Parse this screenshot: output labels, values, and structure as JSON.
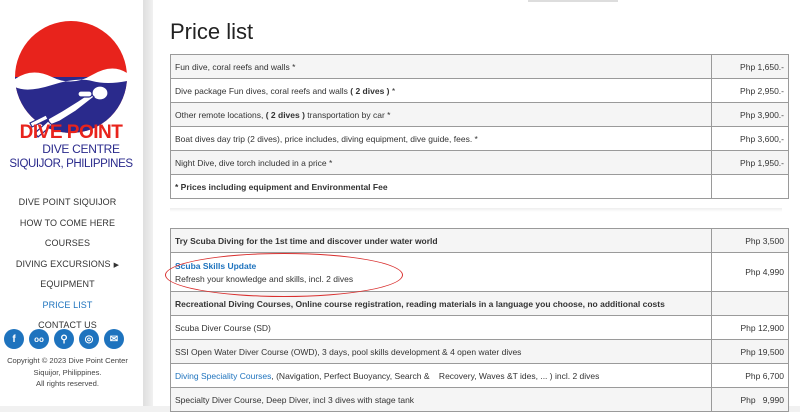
{
  "logo": {
    "line1": "DIVE POINT",
    "line2": "DIVE CENTRE",
    "line3": "SIQUIJOR, PHILIPPINES",
    "colors": {
      "red": "#e8231c",
      "blue": "#2a2a8c"
    }
  },
  "nav": [
    {
      "label": "DIVE POINT SIQUIJOR"
    },
    {
      "label": "HOW TO COME HERE"
    },
    {
      "label": "COURSES"
    },
    {
      "label": "DIVING EXCURSIONS"
    },
    {
      "label": "EQUIPMENT"
    },
    {
      "label": "PRICE LIST"
    },
    {
      "label": "CONTACT US"
    }
  ],
  "social": [
    {
      "icon": "facebook-icon",
      "glyph": "f"
    },
    {
      "icon": "tripadvisor-icon",
      "glyph": "oo"
    },
    {
      "icon": "location-pin-icon",
      "glyph": "⚲"
    },
    {
      "icon": "instagram-icon",
      "glyph": "◎"
    },
    {
      "icon": "email-icon",
      "glyph": "✉"
    }
  ],
  "copyright": {
    "line1": "Copyright © 2023 Dive Point Center",
    "line2": "Siquijor, Philippines.",
    "line3": "All rights reserved."
  },
  "page_title": "Price list",
  "table1": [
    {
      "desc": "Fun dive, coral reefs and walls *",
      "price": "Php 1,650.-"
    },
    {
      "desc_parts": [
        "Dive package Fun dives, coral reefs and walls ",
        "( 2 dives )",
        " *"
      ],
      "price": "Php 2,950.-"
    },
    {
      "desc_parts": [
        "Other remote locations, ",
        "( 2 dives )",
        " transportation by car *"
      ],
      "price": "Php 3,900.-"
    },
    {
      "desc": "Boat dives day trip (2 dives), price includes, diving equipment, dive guide, fees. *",
      "price": "Php 3,600,-"
    },
    {
      "desc": "Night Dive, dive torch included in a price *",
      "price": "Php 1,950.-"
    },
    {
      "desc": "* Prices including equipment and Environmental Fee",
      "price": ""
    }
  ],
  "table2": [
    {
      "desc": "Try Scuba Diving for the 1st time and discover under water world",
      "price": "Php 3,500"
    },
    {
      "link": "Scuba Skills Update",
      "sub": "Refresh your knowledge and skills, incl. 2 dives",
      "price": "Php 4,990"
    },
    {
      "desc": "Recreational Diving Courses, Online course registration, reading materials in a language you choose, no additional costs",
      "price": ""
    },
    {
      "desc": "Scuba Diver Course (SD)",
      "price": "Php 12,900"
    },
    {
      "desc": "SSI Open Water Diver Course (OWD), 3 days, pool skills development & 4 open water dives",
      "price": "Php 19,500"
    },
    {
      "link": "Diving Speciality Courses",
      "rest": ", (Navigation, Perfect Buoyancy, Search &    Recovery, Waves &T ides, ... ) incl. 2 dives",
      "price": "Php 6,700"
    },
    {
      "desc": "Specialty Diver Course, Deep Diver, incl 3 dives with stage tank",
      "price": "Php   9,990"
    }
  ]
}
